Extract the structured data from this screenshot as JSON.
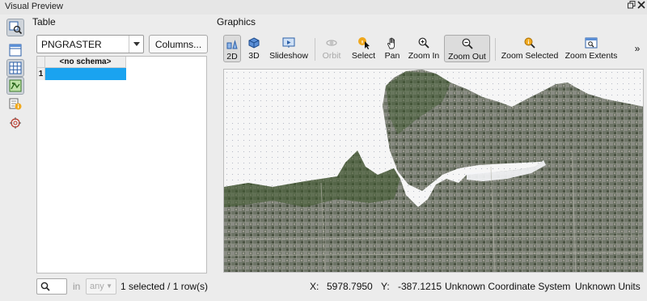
{
  "window": {
    "title": "Visual Preview",
    "restore_icon": "restore-icon",
    "close_icon": "close-icon"
  },
  "sidebar_tools": [
    {
      "name": "inspect-icon",
      "active": true
    },
    {
      "name": "table-layout-icon",
      "active": false
    },
    {
      "name": "grid-icon",
      "active": false
    },
    {
      "name": "map-grid-icon",
      "active": false
    },
    {
      "name": "info-icon",
      "active": false
    },
    {
      "name": "target-icon",
      "active": false
    }
  ],
  "table": {
    "title": "Table",
    "feature_type": "PNGRASTER",
    "columns_button": "Columns...",
    "column_header": "<no schema>",
    "row_number": "1",
    "search_in_label": "in",
    "search_field": "any",
    "selection_info": "1 selected / 1 row(s)"
  },
  "graphics": {
    "title": "Graphics",
    "toolbar": [
      {
        "id": "2d",
        "label": "2D",
        "icon": "2d-view-icon",
        "active": true,
        "disabled": false
      },
      {
        "id": "3d",
        "label": "3D",
        "icon": "3d-view-icon",
        "active": false,
        "disabled": false
      },
      {
        "id": "slideshow",
        "label": "Slideshow",
        "icon": "slideshow-icon",
        "active": false,
        "disabled": false
      },
      {
        "id": "orbit",
        "label": "Orbit",
        "icon": "orbit-icon",
        "active": false,
        "disabled": true
      },
      {
        "id": "select",
        "label": "Select",
        "icon": "select-cursor-icon",
        "active": false,
        "disabled": false
      },
      {
        "id": "pan",
        "label": "Pan",
        "icon": "pan-hand-icon",
        "active": false,
        "disabled": false
      },
      {
        "id": "zoom_in",
        "label": "Zoom In",
        "icon": "zoom-in-icon",
        "active": false,
        "disabled": false
      },
      {
        "id": "zoom_out",
        "label": "Zoom Out",
        "icon": "zoom-out-icon",
        "active": true,
        "disabled": false
      },
      {
        "id": "zoom_selected",
        "label": "Zoom Selected",
        "icon": "zoom-selected-icon",
        "active": false,
        "disabled": false
      },
      {
        "id": "zoom_extents",
        "label": "Zoom Extents",
        "icon": "zoom-extents-icon",
        "active": false,
        "disabled": false
      }
    ],
    "overflow_label": "»",
    "colors": {
      "land": "#5c6650",
      "water": "#f5f6fa",
      "vegetation": "#3f5a2e",
      "urban": "#7d8078"
    }
  },
  "status": {
    "x_label": "X:",
    "x_value": "5978.7950",
    "y_label": "Y:",
    "y_value": "-387.1215",
    "coordinate_system": "Unknown Coordinate System",
    "units": "Unknown Units"
  }
}
